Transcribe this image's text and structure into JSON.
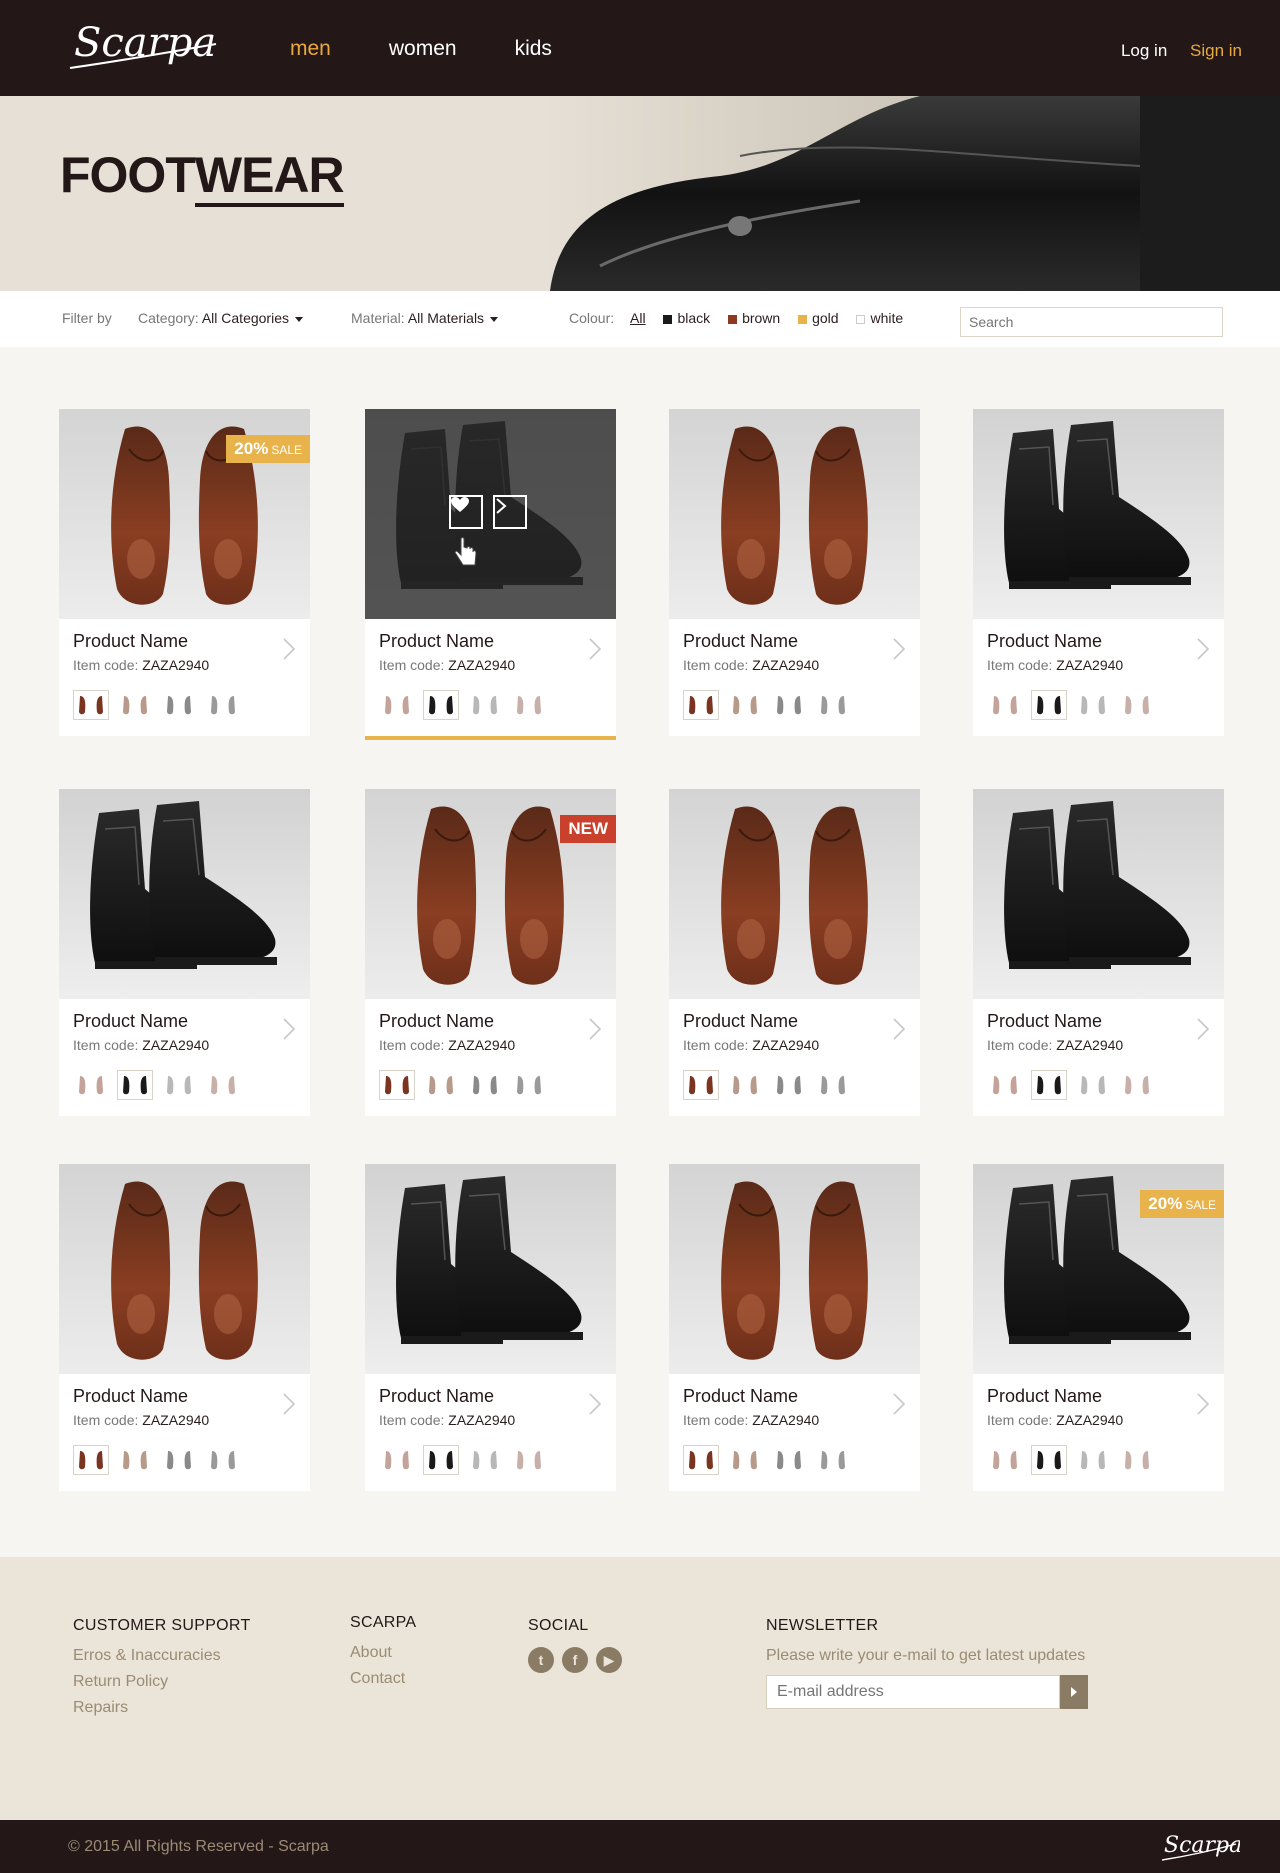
{
  "header": {
    "logo": "Scarpa",
    "nav": [
      {
        "label": "men",
        "active": true
      },
      {
        "label": "women",
        "active": false
      },
      {
        "label": "kids",
        "active": false
      }
    ],
    "login": "Log in",
    "signin": "Sign in"
  },
  "hero": {
    "title_part1": "FOOT",
    "title_part2": "WEAR"
  },
  "filters": {
    "filter_by": "Filter by",
    "category_label": "Category:",
    "category_value": "All Categories",
    "material_label": "Material:",
    "material_value": "All Materials",
    "colour_label": "Colour:",
    "colour_all": "All",
    "colours": [
      {
        "name": "black",
        "color": "#1a1a1a"
      },
      {
        "name": "brown",
        "color": "#8e3a22"
      },
      {
        "name": "gold",
        "color": "#e8b34a"
      },
      {
        "name": "white",
        "color": "#ffffff"
      }
    ],
    "search_placeholder": "Search"
  },
  "products": [
    {
      "name": "Product Name",
      "code_label": "Item code:",
      "code": "ZAZA2940",
      "type": "oxford",
      "badge": "sale",
      "badge_text": "20%",
      "badge_sub": "SALE"
    },
    {
      "name": "Product Name",
      "code_label": "Item code:",
      "code": "ZAZA2940",
      "type": "boot",
      "hover": true
    },
    {
      "name": "Product Name",
      "code_label": "Item code:",
      "code": "ZAZA2940",
      "type": "oxford"
    },
    {
      "name": "Product Name",
      "code_label": "Item code:",
      "code": "ZAZA2940",
      "type": "boot"
    },
    {
      "name": "Product Name",
      "code_label": "Item code:",
      "code": "ZAZA2940",
      "type": "boot"
    },
    {
      "name": "Product Name",
      "code_label": "Item code:",
      "code": "ZAZA2940",
      "type": "oxford",
      "badge": "new",
      "badge_text": "NEW"
    },
    {
      "name": "Product Name",
      "code_label": "Item code:",
      "code": "ZAZA2940",
      "type": "oxford"
    },
    {
      "name": "Product Name",
      "code_label": "Item code:",
      "code": "ZAZA2940",
      "type": "boot"
    },
    {
      "name": "Product Name",
      "code_label": "Item code:",
      "code": "ZAZA2940",
      "type": "oxford"
    },
    {
      "name": "Product Name",
      "code_label": "Item code:",
      "code": "ZAZA2940",
      "type": "boot"
    },
    {
      "name": "Product Name",
      "code_label": "Item code:",
      "code": "ZAZA2940",
      "type": "oxford"
    },
    {
      "name": "Product Name",
      "code_label": "Item code:",
      "code": "ZAZA2940",
      "type": "boot",
      "badge": "sale",
      "badge_text": "20%",
      "badge_sub": "SALE"
    }
  ],
  "footer": {
    "support_title": "CUSTOMER SUPPORT",
    "support_links": [
      "Erros & Inaccuracies",
      "Return Policy",
      "Repairs"
    ],
    "scarpa_title": "SCARPA",
    "scarpa_links": [
      "About",
      "Contact"
    ],
    "social_title": "SOCIAL",
    "social": [
      "twitter-icon",
      "facebook-icon",
      "youtube-icon"
    ],
    "newsletter_title": "NEWSLETTER",
    "newsletter_text": "Please write your e-mail to get latest updates",
    "newsletter_placeholder": "E-mail address",
    "copyright": "© 2015 All Rights Reserved  -  Scarpa"
  },
  "colors": {
    "dark": "#241718",
    "gold": "#e8a93f",
    "sale": "#e8b34a",
    "new": "#c9412d",
    "footer_bg": "#ebe4d8"
  }
}
